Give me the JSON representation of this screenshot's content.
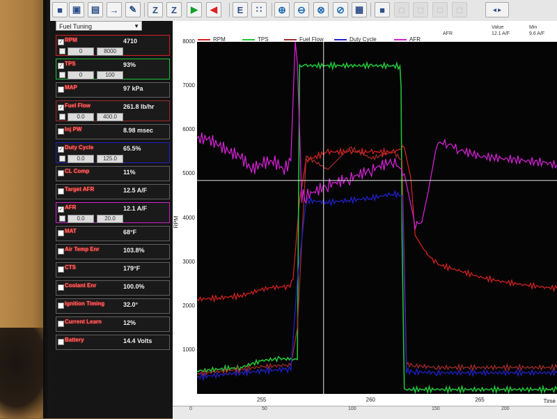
{
  "toolbar": {
    "icons": [
      "open-folder-icon",
      "save-icon",
      "save-as-icon",
      "export-icon",
      "notes-icon",
      "zoom-a-icon",
      "zoom-z-icon",
      "play-icon",
      "back-icon",
      "e-icon",
      "grid-icon",
      "zoom-in-icon",
      "zoom-out-icon",
      "zoom-fit-icon",
      "zoom-reset-icon",
      "table-icon",
      "folder-icon",
      "disabled-icon",
      "disabled-icon",
      "disabled-icon",
      "disabled-icon"
    ]
  },
  "panel": {
    "view_select": "Fuel Tuning",
    "channels": [
      {
        "name": "RPM",
        "value": "4710",
        "checked": true,
        "min": "0",
        "max": "8000",
        "color": "#d42020"
      },
      {
        "name": "TPS",
        "value": "93%",
        "checked": true,
        "min": "0",
        "max": "100",
        "color": "#22c33a"
      },
      {
        "name": "MAP",
        "value": "97 kPa",
        "checked": false
      },
      {
        "name": "Fuel Flow",
        "value": "261.8 lb/hr",
        "checked": true,
        "min": "0.0",
        "max": "400.0",
        "color": "#a32a2a"
      },
      {
        "name": "Inj PW",
        "value": "8.98 msec",
        "checked": false
      },
      {
        "name": "Duty Cycle",
        "value": "65.5%",
        "checked": true,
        "min": "0.0",
        "max": "125.0",
        "color": "#2020c8"
      },
      {
        "name": "CL Comp",
        "value": "11%",
        "checked": false
      },
      {
        "name": "Target AFR",
        "value": "12.5 A/F",
        "checked": false
      },
      {
        "name": "AFR",
        "value": "12.1 A/F",
        "checked": true,
        "min": "0.0",
        "max": "20.0",
        "color": "#d020d0"
      },
      {
        "name": "MAT",
        "value": "68°F",
        "checked": false
      },
      {
        "name": "Air Temp Enr",
        "value": "103.8%",
        "checked": false
      },
      {
        "name": "CTS",
        "value": "179°F",
        "checked": false
      },
      {
        "name": "Coolant Enr",
        "value": "100.0%",
        "checked": false
      },
      {
        "name": "Ignition Timing",
        "value": "32.0°",
        "checked": false
      },
      {
        "name": "Current Learn",
        "value": "12%",
        "checked": false
      },
      {
        "name": "Battery",
        "value": "14.4 Volts",
        "checked": false
      }
    ]
  },
  "graph": {
    "legend": [
      "RPM",
      "TPS",
      "Fuel Flow",
      "Duty Cycle",
      "AFR"
    ],
    "value_table": {
      "headers": [
        "Value",
        "Min"
      ],
      "row": {
        "name": "AFR",
        "value": "12.1 A/F",
        "min": "9.6 A/F"
      }
    },
    "y_label": "RPM",
    "y_ticks": [
      "8000",
      "7000",
      "6000",
      "5000",
      "4000",
      "3000",
      "2000",
      "1000"
    ],
    "x_ticks": [
      "255",
      "260",
      "265"
    ],
    "x_label": "Time",
    "scroll_ticks": [
      "0",
      "50",
      "100",
      "150",
      "200"
    ]
  },
  "chart_data": {
    "type": "line",
    "xlabel": "Time",
    "ylabel": "RPM",
    "xlim": [
      252.0,
      268.5
    ],
    "ylim": [
      0,
      8000
    ],
    "grid": false,
    "legend": "top",
    "series": [
      {
        "name": "RPM",
        "color": "#d42020",
        "x": [
          252.0,
          253.0,
          254.0,
          254.5,
          255.0,
          255.5,
          256.0,
          256.2,
          256.4,
          256.7,
          257.0,
          258.0,
          259.0,
          260.0,
          261.0,
          261.5,
          261.8,
          262.0,
          262.5,
          263.0,
          264.0,
          265.0,
          266.0,
          267.0,
          268.0,
          268.5
        ],
        "y": [
          2150,
          2180,
          2230,
          2300,
          2380,
          2420,
          2430,
          2420,
          2600,
          4400,
          5300,
          5500,
          5500,
          5500,
          5500,
          5600,
          4900,
          3600,
          3200,
          2950,
          2800,
          2650,
          2550,
          2480,
          2420,
          2400
        ]
      },
      {
        "name": "TPS",
        "color": "#22c33a",
        "x": [
          252.0,
          254.0,
          255.0,
          255.8,
          256.3,
          256.6,
          256.7,
          257.0,
          260.0,
          261.3,
          261.35,
          261.4,
          261.5,
          263.0,
          268.5
        ],
        "y": [
          520,
          600,
          760,
          800,
          790,
          780,
          7450,
          7460,
          7460,
          7450,
          7000,
          3500,
          100,
          100,
          100
        ]
      },
      {
        "name": "Fuel Flow",
        "color": "#a32a2a",
        "x": [
          252.0,
          254.0,
          255.0,
          256.0,
          256.3,
          256.6,
          257.0,
          258.0,
          259.0,
          260.0,
          261.0,
          261.4,
          261.6,
          262.0,
          263.0,
          268.5
        ],
        "y": [
          460,
          560,
          620,
          650,
          640,
          1500,
          5400,
          5100,
          5600,
          5350,
          5500,
          5300,
          680,
          640,
          600,
          600
        ]
      },
      {
        "name": "Duty Cycle",
        "color": "#2020c8",
        "x": [
          252.0,
          254.0,
          255.0,
          256.0,
          256.3,
          256.6,
          257.0,
          258.0,
          259.0,
          260.0,
          261.0,
          261.4,
          261.6,
          262.0,
          263.0,
          268.5
        ],
        "y": [
          380,
          480,
          520,
          560,
          540,
          2600,
          4400,
          4350,
          4400,
          4450,
          4550,
          4500,
          520,
          500,
          480,
          480
        ]
      },
      {
        "name": "AFR",
        "color": "#d020d0",
        "x": [
          252.0,
          252.5,
          253.0,
          253.5,
          254.0,
          254.5,
          255.0,
          255.5,
          256.0,
          256.3,
          256.5,
          256.6,
          256.8,
          257.0,
          258.0,
          259.0,
          260.0,
          261.0,
          261.5,
          261.8,
          262.0,
          262.3,
          262.6,
          263.0,
          263.5,
          264.0,
          265.0,
          266.0,
          267.0,
          268.0,
          268.5
        ],
        "y": [
          5800,
          5800,
          5650,
          5500,
          5400,
          5100,
          5250,
          5300,
          5100,
          5300,
          8000,
          7500,
          4500,
          4500,
          4750,
          4900,
          5100,
          5300,
          5000,
          4300,
          3850,
          3900,
          4600,
          5700,
          5700,
          5550,
          5400,
          5350,
          5300,
          5250,
          5200
        ]
      }
    ],
    "cursor": {
      "x": 257.8,
      "y": 4850
    }
  }
}
